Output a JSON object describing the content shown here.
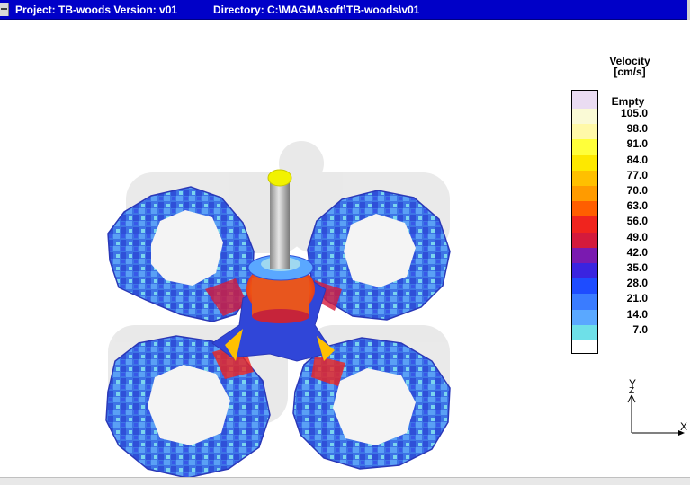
{
  "window": {
    "project": "Project: TB-woods Version: v01",
    "directory": "Directory: C:\\MAGMAsoft\\TB-woods\\v01"
  },
  "legend": {
    "title_line1": "Velocity",
    "title_line2": "[cm/s]",
    "empty_label": "Empty",
    "empty_color": "#eadcf2",
    "cells": [
      {
        "label": "105.0",
        "color": "#fafad6"
      },
      {
        "label": "98.0",
        "color": "#fff9a8"
      },
      {
        "label": "91.0",
        "color": "#ffff3a"
      },
      {
        "label": "84.0",
        "color": "#fde800"
      },
      {
        "label": "77.0",
        "color": "#ffc000"
      },
      {
        "label": "70.0",
        "color": "#ff9b00"
      },
      {
        "label": "63.0",
        "color": "#ff5e00"
      },
      {
        "label": "56.0",
        "color": "#f0241e"
      },
      {
        "label": "49.0",
        "color": "#d41a3c"
      },
      {
        "label": "42.0",
        "color": "#7a1ab0"
      },
      {
        "label": "35.0",
        "color": "#3a24e0"
      },
      {
        "label": "28.0",
        "color": "#1e4cff"
      },
      {
        "label": "21.0",
        "color": "#3a7cff"
      },
      {
        "label": "14.0",
        "color": "#5aa8ff"
      },
      {
        "label": "7.0",
        "color": "#6ee0e8"
      }
    ]
  },
  "axes": {
    "y_label": "Y",
    "z_label": "Z",
    "x_label": "X"
  }
}
